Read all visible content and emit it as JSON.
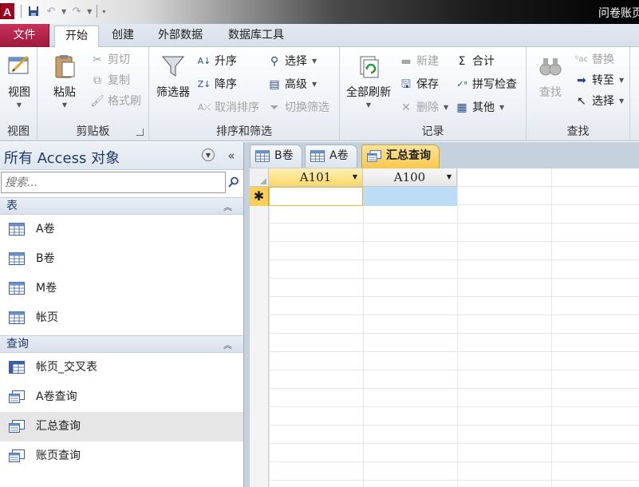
{
  "window": {
    "title": "问卷账页",
    "app_icon_letter": "A"
  },
  "ribbon_tabs": [
    {
      "label": "文件"
    },
    {
      "label": "开始"
    },
    {
      "label": "创建"
    },
    {
      "label": "外部数据"
    },
    {
      "label": "数据库工具"
    }
  ],
  "ribbon": {
    "views": {
      "view": "视图",
      "label": "视图"
    },
    "clipboard": {
      "paste": "粘贴",
      "cut": "剪切",
      "copy": "复制",
      "format_painter": "格式刷",
      "label": "剪贴板"
    },
    "sort_filter": {
      "filter": "筛选器",
      "ascending": "升序",
      "descending": "降序",
      "clear_sort": "取消排序",
      "selection": "选择",
      "advanced": "高级",
      "toggle_filter": "切换筛选",
      "label": "排序和筛选"
    },
    "records": {
      "refresh_all": "全部刷新",
      "new": "新建",
      "save": "保存",
      "delete": "删除",
      "totals": "合计",
      "spelling": "拼写检查",
      "more": "其他",
      "label": "记录"
    },
    "find": {
      "find": "查找",
      "replace": "替换",
      "goto": "转至",
      "select": "选择",
      "label": "查找"
    }
  },
  "navpane": {
    "title": "所有 Access 对象",
    "search_placeholder": "搜索...",
    "sections": [
      {
        "label": "表",
        "items": [
          "A卷",
          "B卷",
          "M卷",
          "帐页"
        ]
      },
      {
        "label": "查询",
        "items": [
          "帐页_交叉表",
          "A卷查询",
          "汇总查询",
          "账页查询"
        ]
      }
    ],
    "selected_item": "汇总查询"
  },
  "document": {
    "tabs": [
      {
        "label": "B卷",
        "type": "table"
      },
      {
        "label": "A卷",
        "type": "table"
      },
      {
        "label": "汇总查询",
        "type": "query",
        "active": true
      }
    ],
    "columns": [
      "A101",
      "A100"
    ],
    "new_row_marker": "✱"
  },
  "colors": {
    "file_tab": "#b02148",
    "active_doc_tab": "#f7c84a",
    "selected_header": "#f9d86a",
    "highlight_cell": "#bddcf6"
  }
}
